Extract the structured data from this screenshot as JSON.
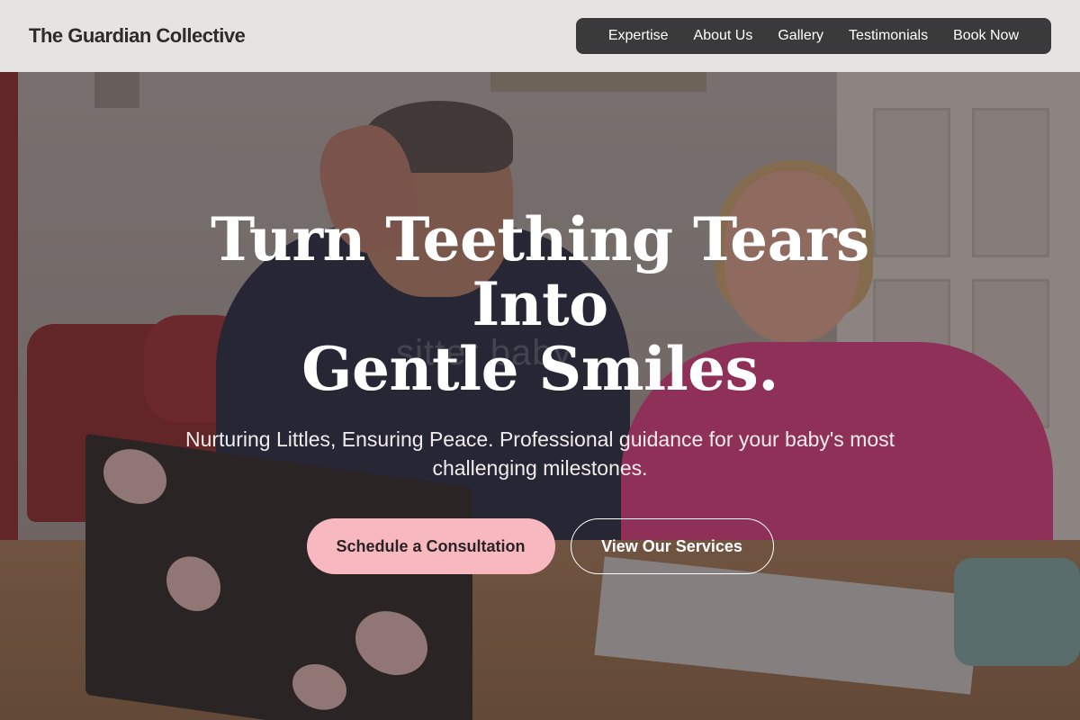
{
  "header": {
    "brand": "The Guardian Collective",
    "nav": [
      {
        "label": "Expertise"
      },
      {
        "label": "About Us"
      },
      {
        "label": "Gallery"
      },
      {
        "label": "Testimonials"
      },
      {
        "label": "Book Now"
      }
    ]
  },
  "hero": {
    "headline_line1": "Turn Teething Tears Into",
    "headline_line2": "Gentle Smiles.",
    "subline": "Nurturing Littles, Ensuring Peace. Professional guidance for your baby's most challenging milestones.",
    "watermark": "sitter baby",
    "primary_cta": "Schedule a Consultation",
    "secondary_cta": "View Our Services"
  },
  "colors": {
    "primary_button": "#f7b8c0",
    "nav_background": "#3a3a3a",
    "header_background": "#eceae8"
  }
}
